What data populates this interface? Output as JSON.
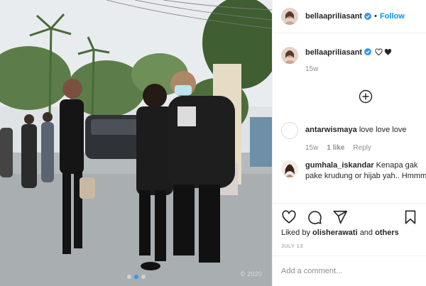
{
  "post": {
    "author": "bellaapriliasant",
    "follow_label": "Follow",
    "separator": "•",
    "caption_emoji": [
      "heart-outline",
      "heart-filled"
    ],
    "caption_time": "15w",
    "carousel": {
      "count": 3,
      "active_index": 1
    },
    "watermark": "© 2020"
  },
  "comments": [
    {
      "user": "antarwismaya",
      "text": "love love love",
      "time": "15w",
      "likes": "1 like",
      "reply": "Reply"
    },
    {
      "user": "gumhala_iskandar",
      "text": "Kenapa gak pake krudung or hijab yah.. Hmmm"
    }
  ],
  "actions": {
    "liked_by_prefix": "Liked by",
    "liked_by_user": "olisherawati",
    "liked_by_joiner": "and",
    "liked_by_others": "others",
    "date": "JULY 13"
  },
  "composer": {
    "placeholder": "Add a comment..."
  },
  "colors": {
    "accent": "#0095f6",
    "verified": "#3897f0",
    "muted": "#8e8e8e",
    "border": "#efefef"
  }
}
